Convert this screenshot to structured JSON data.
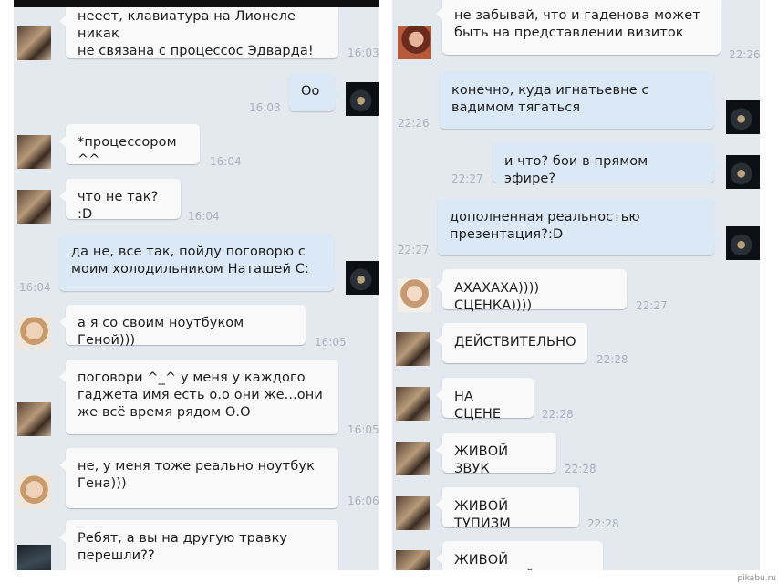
{
  "left_messages": [
    {
      "text": "нееет, клавиатура на Лионеле никак\nне связана с процессос Эдварда!",
      "time": "16:03",
      "side": "in"
    },
    {
      "text": "Оо",
      "time": "16:03",
      "side": "out"
    },
    {
      "text": "*процессором ^^",
      "time": "16:04",
      "side": "in"
    },
    {
      "text": "что не так? :D",
      "time": "16:04",
      "side": "in"
    },
    {
      "text": "да не, все так, пойду поговорю с\nмоим холодильником Наташей С:",
      "time": "16:04",
      "side": "out"
    },
    {
      "text": "а я со своим ноутбуком Геной)))",
      "time": "16:05",
      "side": "in"
    },
    {
      "text": "поговори ^_^ у меня у каждого\nгаджета имя есть о.о они же...они\nже всё время рядом О.О",
      "time": "16:05",
      "side": "in"
    },
    {
      "text": "не, у меня тоже реально ноутбук\nГена)))",
      "time": "16:06",
      "side": "in"
    },
    {
      "text": "Ребят, а вы на другую травку\nперешли??",
      "time": "",
      "side": "in"
    }
  ],
  "right_messages": [
    {
      "text": "не забывай, что и гаденова может\nбыть на представлении визиток",
      "time": "22:26",
      "side": "in"
    },
    {
      "text": "конечно, куда игнатьевне с\nвадимом тягаться",
      "time": "22:26",
      "side": "out"
    },
    {
      "text": "и что? бои в прямом эфире?",
      "time": "22:27",
      "side": "out"
    },
    {
      "text": "дополненная реальностью\nпрезентация?:D",
      "time": "22:27",
      "side": "out"
    },
    {
      "text": "АХАХАХА)))) СЦЕНКА))))",
      "time": "22:27",
      "side": "in"
    },
    {
      "text": "ДЕЙСТВИТЕЛЬНО",
      "time": "22:28",
      "side": "in"
    },
    {
      "text": "НА СЦЕНЕ",
      "time": "22:28",
      "side": "in"
    },
    {
      "text": "ЖИВОЙ ЗВУК",
      "time": "22:28",
      "side": "in"
    },
    {
      "text": "ЖИВОЙ ТУПИЗМ",
      "time": "22:28",
      "side": "in"
    },
    {
      "text": "ЖИВОЙ МОРДОБОЙ",
      "time": "",
      "side": "in"
    }
  ],
  "watermark": "pikabu.ru"
}
